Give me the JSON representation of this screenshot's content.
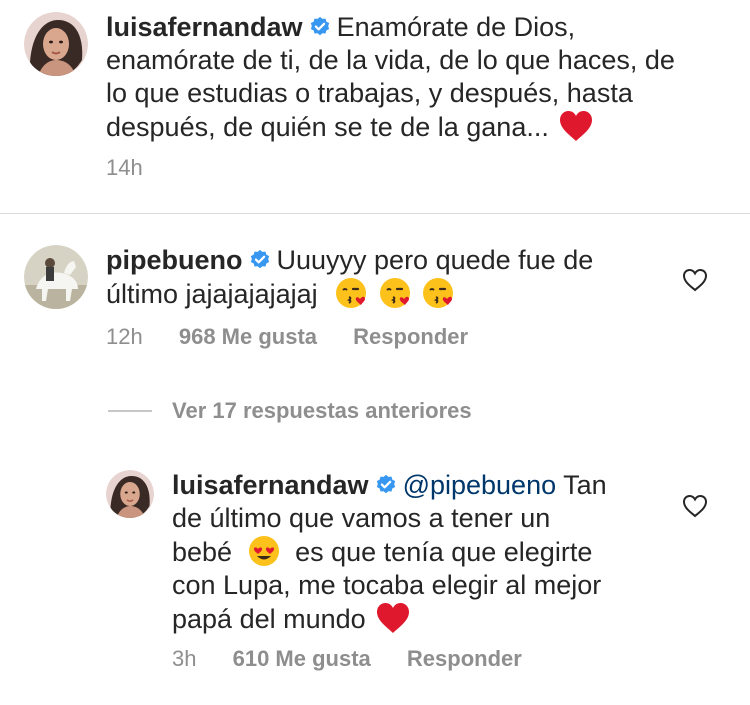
{
  "caption": {
    "username": "luisafernandaw",
    "lines": [
      "Enamórate de Dios,",
      "enamórate de ti, de la vida, de lo que haces, de",
      "lo que estudias o trabajas, y después, hasta",
      "después, de quién se te de la gana..."
    ],
    "time": "14h",
    "emoji": "red-heart"
  },
  "comments": [
    {
      "username": "pipebueno",
      "line1": "Uuuyyy pero quede fue de",
      "line2": "último jajajajajajaj",
      "emojis": [
        "kissing-face-with-heart",
        "kissing-face-with-heart",
        "kissing-face-with-heart"
      ],
      "time": "12h",
      "likes": "968 Me gusta",
      "reply": "Responder"
    }
  ],
  "view_replies": "Ver 17 respuestas anteriores",
  "reply": {
    "username": "luisafernandaw",
    "mention": "@pipebueno",
    "line1": "Tan",
    "line2": "de último que vamos a tener un",
    "line3a": "bebé",
    "line3b": "es que tenía que elegirte",
    "line4": "con Lupa, me tocaba elegir al mejor",
    "line5": "papá del mundo",
    "time": "3h",
    "likes": "610 Me gusta",
    "reply_label": "Responder"
  },
  "colors": {
    "verified": "#3897f0",
    "heart": "#e0182d",
    "meta": "#8e8e8e",
    "mention": "#00376b"
  }
}
